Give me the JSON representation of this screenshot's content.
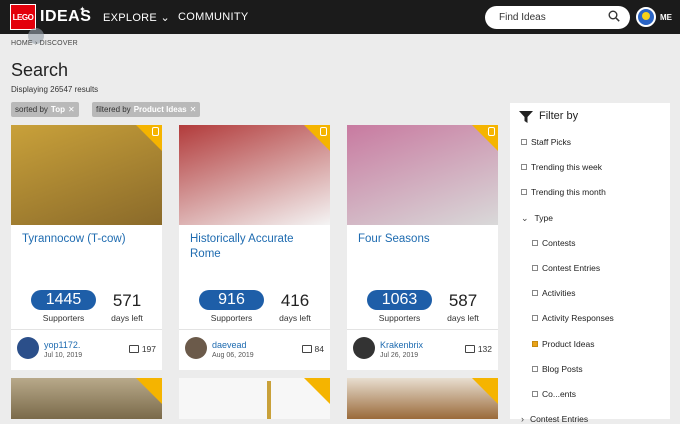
{
  "header": {
    "logo_text": "LEGO",
    "brand": "IDEAS",
    "nav": [
      {
        "label": "EXPLORE"
      },
      {
        "label": "COMMUNITY"
      }
    ],
    "search_placeholder": "Find Ideas",
    "user_label": "ME"
  },
  "breadcrumb": {
    "home": "HOME",
    "sep": "›",
    "current": "DISCOVER"
  },
  "page": {
    "title": "Search",
    "results": "Displaying 26547 results"
  },
  "chips": [
    {
      "prefix": "sorted by",
      "value": "Top",
      "remove": "✕"
    },
    {
      "prefix": "filtered by",
      "value": "Product Ideas",
      "remove": "✕"
    }
  ],
  "cards": [
    {
      "title": "Tyrannocow (T-cow)",
      "supporters": "1445",
      "supporters_label": "Supporters",
      "days": "571",
      "days_label": "days left",
      "user": "yop1172.",
      "date": "Jul 10, 2019",
      "comments": "197",
      "img_colors": [
        "#8a6a2a",
        "#c9a13a"
      ],
      "avatar_color": "#2b4f8a"
    },
    {
      "title": "Historically Accurate Rome",
      "supporters": "916",
      "supporters_label": "Supporters",
      "days": "416",
      "days_label": "days left",
      "user": "daevead",
      "date": "Aug 06, 2019",
      "comments": "84",
      "img_colors": [
        "#f4f4f4",
        "#b23b3b"
      ],
      "avatar_color": "#6b5a4a"
    },
    {
      "title": "Four Seasons",
      "supporters": "1063",
      "supporters_label": "Supporters",
      "days": "587",
      "days_label": "days left",
      "user": "Krakenbrix",
      "date": "Jul 26, 2019",
      "comments": "132",
      "img_colors": [
        "#d9d9d9",
        "#c87aa0"
      ],
      "avatar_color": "#333333"
    }
  ],
  "filter": {
    "title": "Filter by",
    "items": [
      {
        "label": "Staff Picks",
        "checked": false,
        "indent": 0
      },
      {
        "label": "Trending this week",
        "checked": false,
        "indent": 0
      },
      {
        "label": "Trending this month",
        "checked": false,
        "indent": 0
      },
      {
        "label": "Type",
        "checked": false,
        "indent": 0,
        "expander": "⌄"
      },
      {
        "label": "Contests",
        "checked": false,
        "indent": 1
      },
      {
        "label": "Contest Entries",
        "checked": false,
        "indent": 1
      },
      {
        "label": "Activities",
        "checked": false,
        "indent": 1
      },
      {
        "label": "Activity Responses",
        "checked": false,
        "indent": 1
      },
      {
        "label": "Product Ideas",
        "checked": true,
        "indent": 1
      },
      {
        "label": "Blog Posts",
        "checked": false,
        "indent": 1
      },
      {
        "label": "Co...ents",
        "checked": false,
        "indent": 1
      },
      {
        "label": "Contest Entries",
        "checked": false,
        "indent": 0,
        "expander": "›"
      }
    ]
  },
  "colors": {
    "accent": "#1e5ea8",
    "link": "#1e6bb0",
    "corner": "#f5b400",
    "header": "#1b1b1b",
    "checked": "#e9a319"
  }
}
